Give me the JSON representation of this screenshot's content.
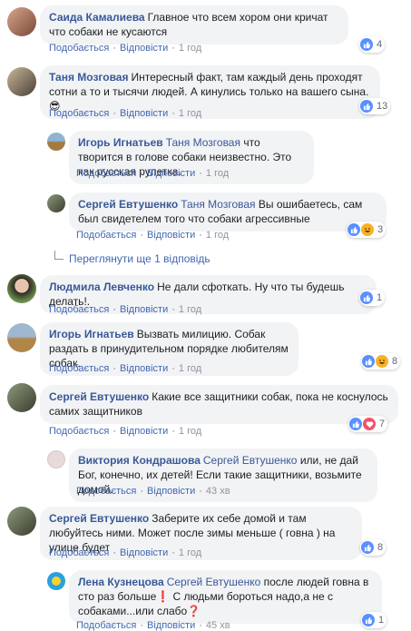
{
  "labels": {
    "like": "Подобається",
    "reply": "Відповісти",
    "dot": "·"
  },
  "comments": [
    {
      "author": "Саида Камалиева",
      "text": "Главное что всем хором они кричат что собаки не кусаются",
      "time": "1 год",
      "reactions": 4,
      "reaction_icons": [
        "like-icon"
      ]
    },
    {
      "author": "Таня Мозговая",
      "text": "Интересный факт, там каждый день проходят сотни а то и тысячи людей. А кинулись только на вашего сына.",
      "emoji": "😎",
      "time": "1 год",
      "reactions": 13,
      "reaction_icons": [
        "like-icon"
      ]
    },
    {
      "author": "Игорь Игнатьев",
      "mention": "Таня Мозговая",
      "text": "что творится в голове собаки неизвестно. Это как русская рулетка.",
      "time": "1 год"
    },
    {
      "author": "Сергей Евтушенко",
      "mention": "Таня Мозговая",
      "text": "Вы ошибаетесь, сам был свидетелем того что собаки агрессивные",
      "time": "1 год",
      "reactions": 3,
      "reaction_icons": [
        "like-icon",
        "haha-icon"
      ]
    },
    {
      "author": "Людмила Левченко",
      "text": "Не дали сфоткать. Ну что ты будешь делать!.",
      "time": "1 год",
      "reactions": 1,
      "reaction_icons": [
        "like-icon"
      ]
    },
    {
      "author": "Игорь Игнатьев",
      "text": "Вызвать милицию. Собак раздать в принудительном порядке любителям собак.",
      "time": "1 год",
      "reactions": 8,
      "reaction_icons": [
        "like-icon",
        "haha-icon"
      ]
    },
    {
      "author": "Сергей Евтушенко",
      "text": "Какие все защитники собак, пока не коснулось самих защитников",
      "time": "1 год",
      "reactions": 7,
      "reaction_icons": [
        "like-icon",
        "love-icon"
      ]
    },
    {
      "author": "Виктория Кондрашова",
      "mention": "Сергей Евтушенко",
      "text": "или, не дай Бог, конечно, их детей! Если такие защитники, возьмите домой.",
      "time": "43 хв"
    },
    {
      "author": "Сергей Евтушенко",
      "text": "Заберите их себе домой и там любуйтесь ними. Может после зимы меньше ( говна ) на улице будет",
      "time": "1 год",
      "reactions": 8,
      "reaction_icons": [
        "like-icon"
      ]
    },
    {
      "author": "Лена Кузнецова",
      "mention": "Сергей Евтушенко",
      "text": "после людей говна в сто раз больше❗ С людьми бороться надо,а не с собаками...или слабо❓",
      "time": "45 хв",
      "reactions": 1,
      "reaction_icons": [
        "like-icon"
      ]
    }
  ],
  "replies_link": "Переглянути ще 1 відповідь",
  "colors": {
    "link": "#385898",
    "bubble": "#f2f3f5",
    "like": "#5890ff",
    "haha": "#f7b125",
    "love": "#f25268"
  }
}
